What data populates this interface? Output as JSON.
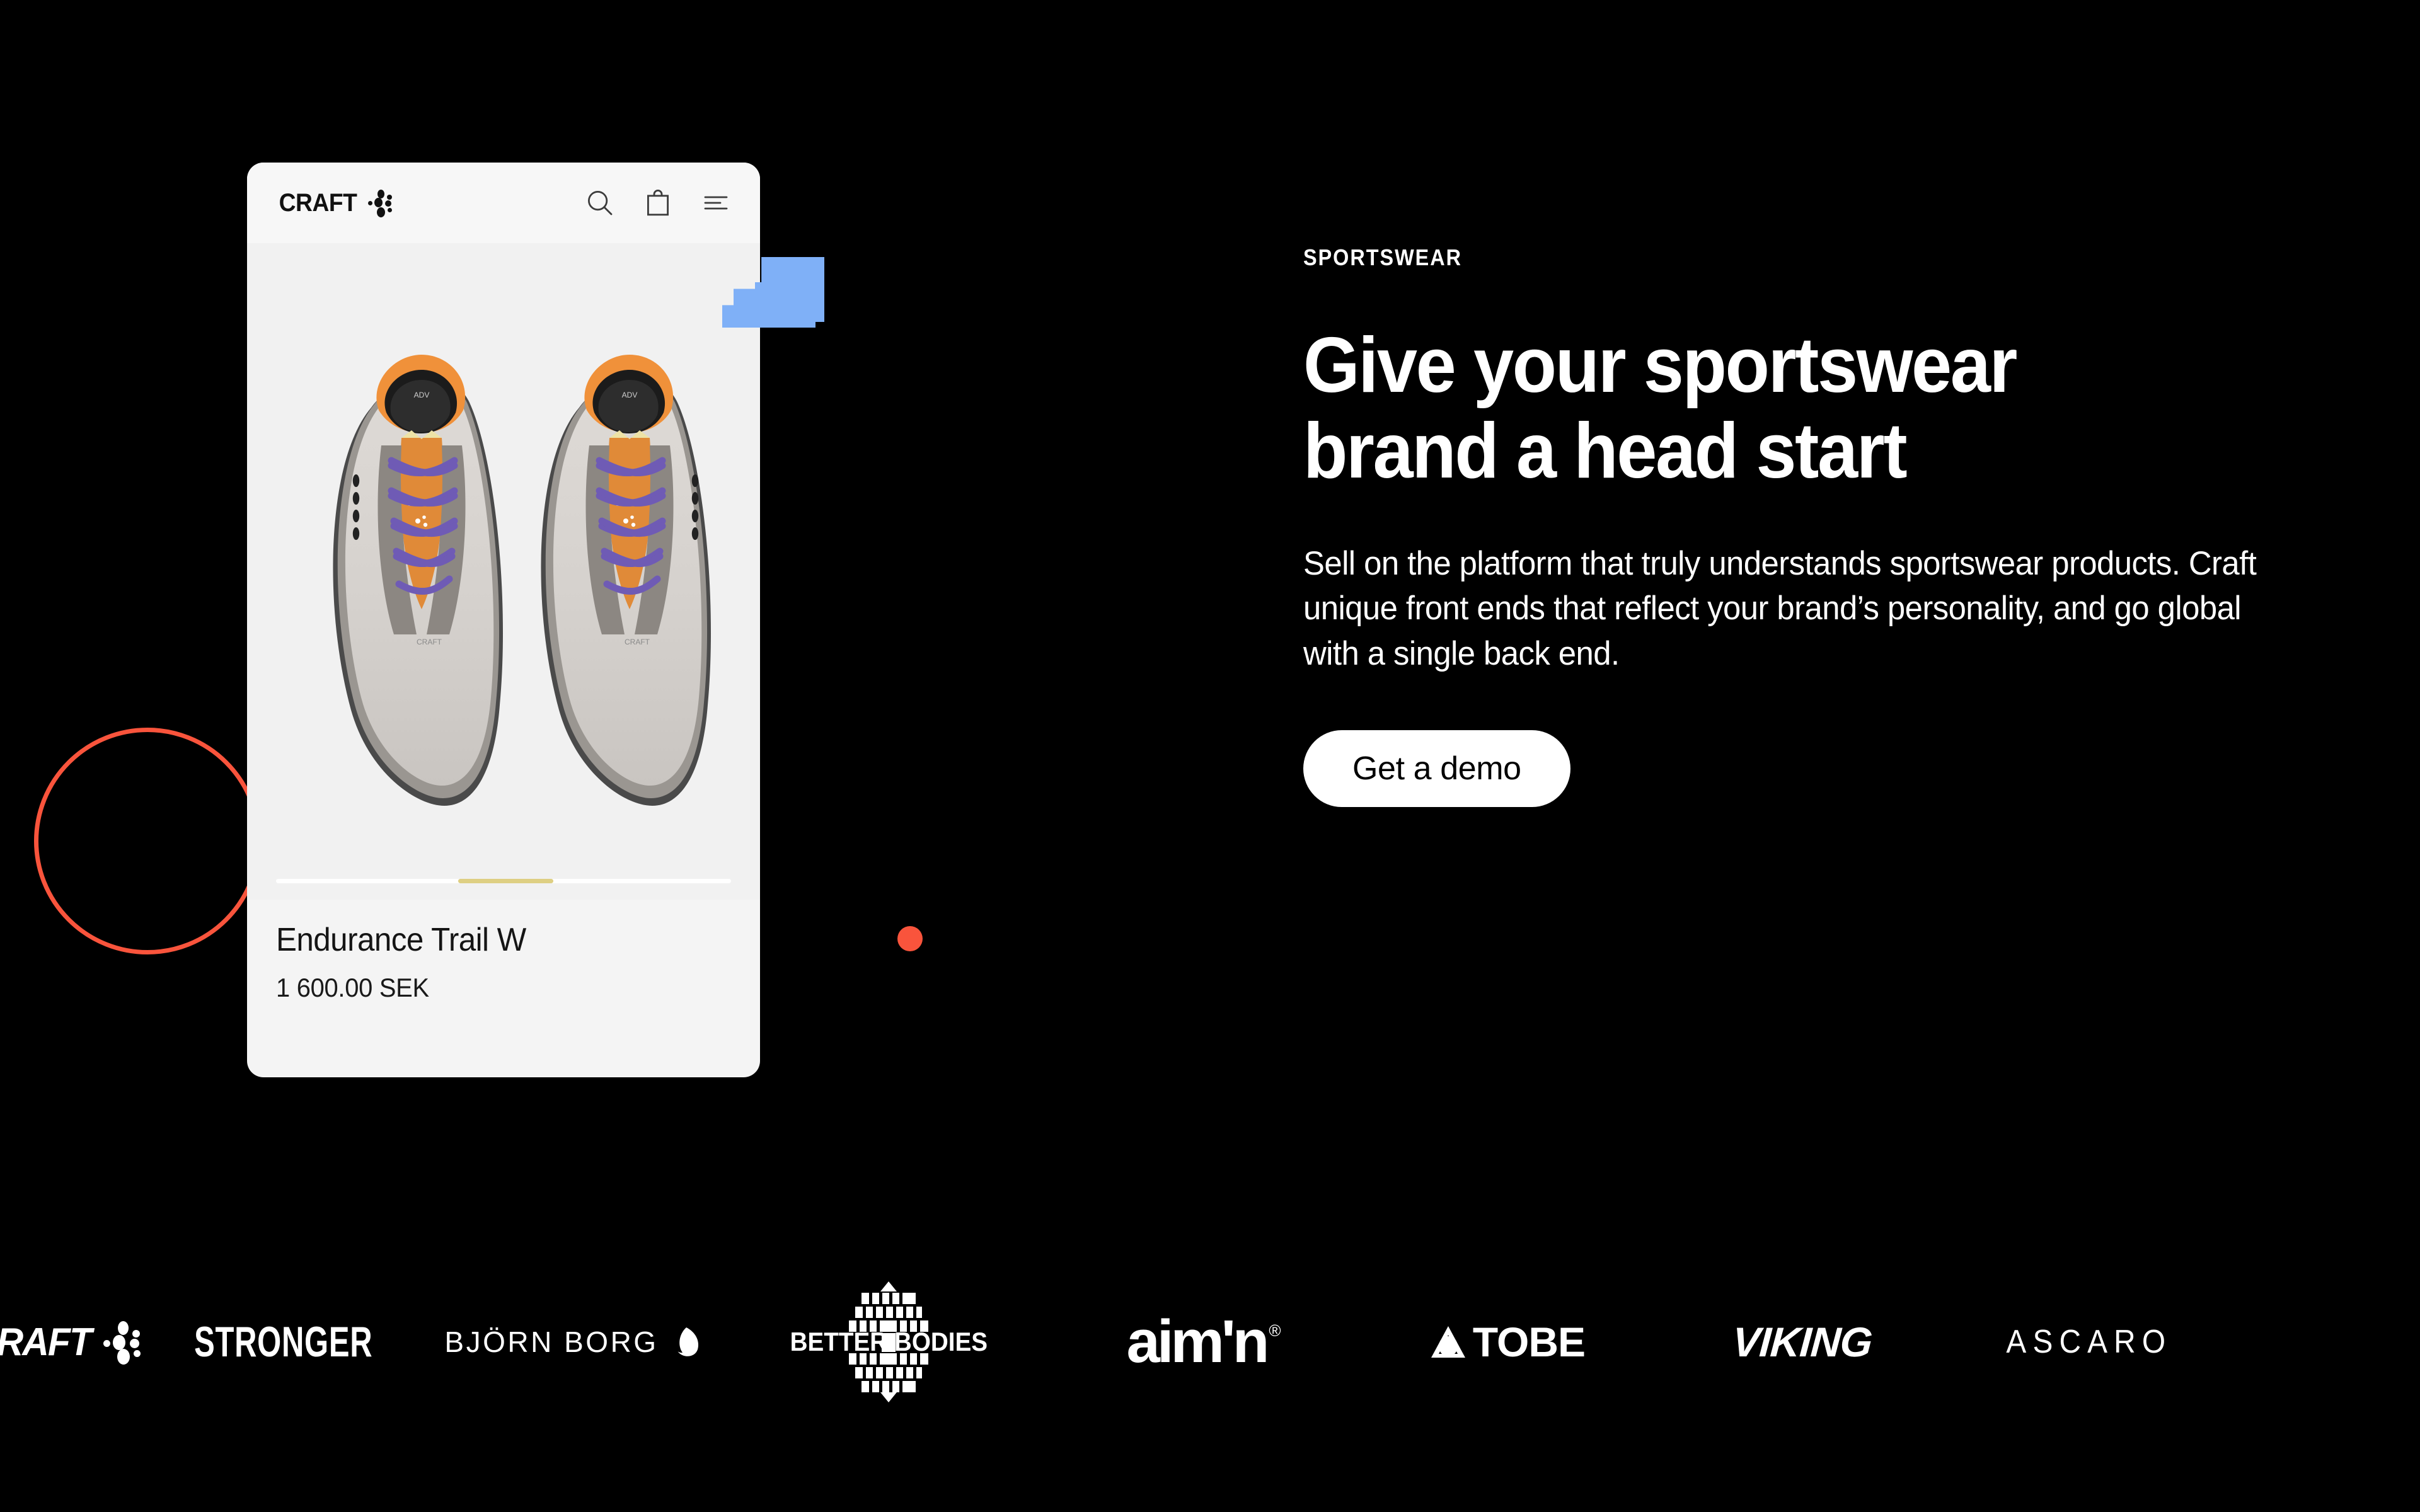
{
  "page": {
    "background_color": "#000000",
    "accent_orange": "#F9543C",
    "accent_blue": "#7FB0F7",
    "accent_gold": "#DECF83"
  },
  "phone": {
    "brand_logo": "CRAFT",
    "brand_logo_icon": "craft-dots-icon",
    "header_icons": [
      {
        "name": "search-icon",
        "label": "Search"
      },
      {
        "name": "shopping-bag-icon",
        "label": "Bag"
      },
      {
        "name": "hamburger-menu-icon",
        "label": "Menu"
      }
    ],
    "product": {
      "image_alt": "Pair of running shoes top view",
      "name": "Endurance Trail W",
      "price": "1 600.00 SEK"
    },
    "carousel": {
      "total": 5,
      "active_index": 2
    }
  },
  "hero": {
    "eyebrow": "SPORTSWEAR",
    "headline_line1": "Give your sportswear",
    "headline_line2": "brand a head start",
    "body": "Sell on the platform that truly understands sportswear products. Craft unique front ends that reflect your brand’s personality, and go global with a single back end.",
    "cta_label": "Get a demo"
  },
  "brands": [
    {
      "name": "craft",
      "label": "CRAFT"
    },
    {
      "name": "stronger",
      "label": "STRONGER"
    },
    {
      "name": "bjorn-borg",
      "label": "BJÖRN BORG"
    },
    {
      "name": "better-bodies",
      "label": "BETTER BODIES"
    },
    {
      "name": "aimn",
      "label": "aim'n",
      "mark": "®"
    },
    {
      "name": "tobe",
      "label": "TOBE"
    },
    {
      "name": "viking",
      "label": "VIKING"
    },
    {
      "name": "ascaro",
      "label": "ASCARO"
    }
  ]
}
